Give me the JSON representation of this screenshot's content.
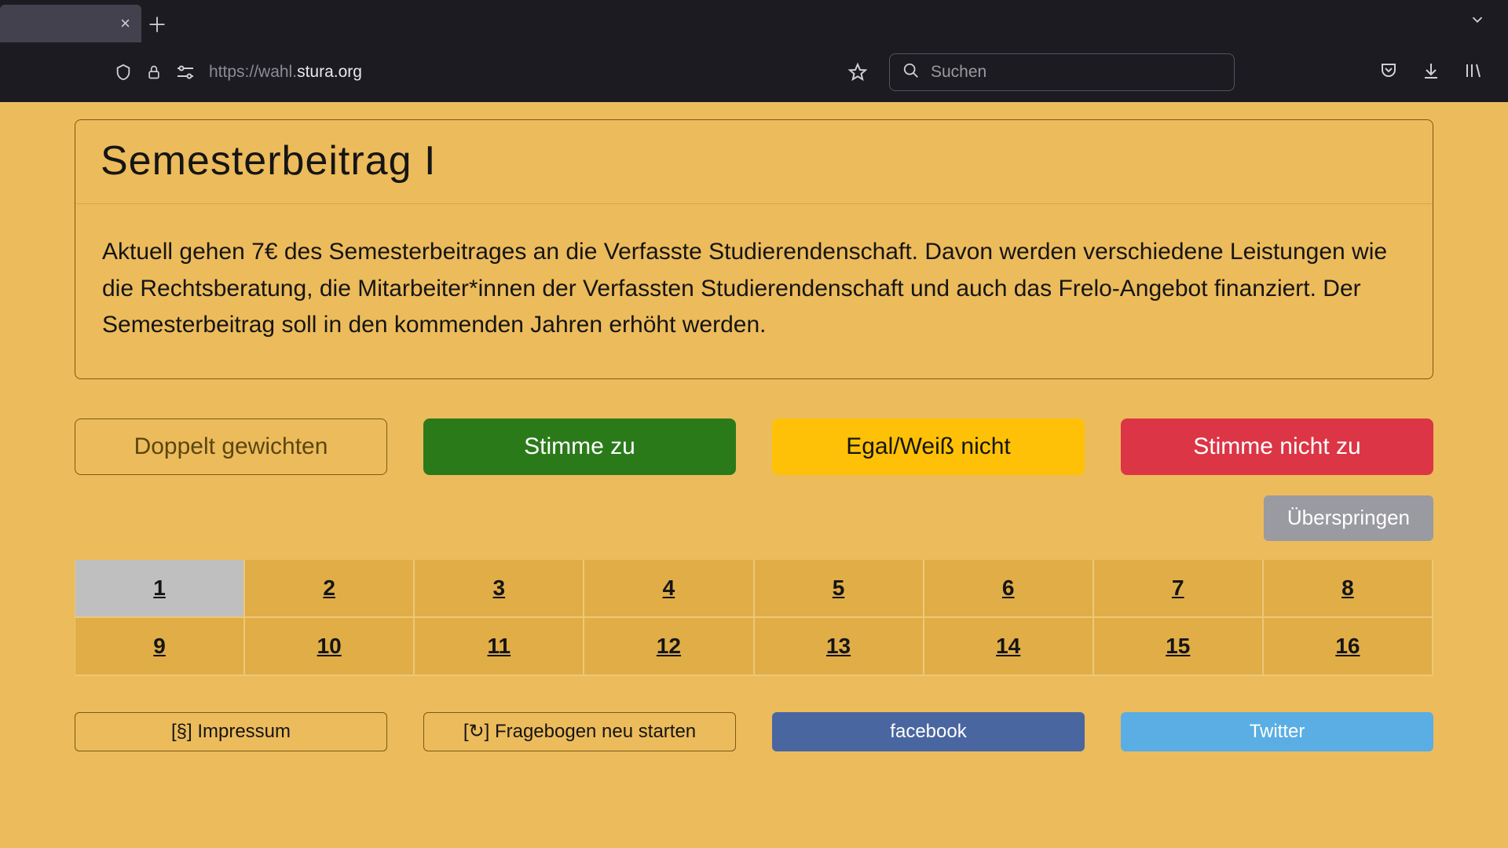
{
  "browser": {
    "url_prefix": "https://wahl.",
    "url_domain": "stura.org",
    "search_placeholder": "Suchen"
  },
  "card": {
    "title": "Semesterbeitrag I",
    "body": "Aktuell gehen 7€ des Semesterbeitrages an die Verfasste Studierendenschaft. Davon werden verschiedene Leistungen wie die Rechtsberatung, die Mitarbeiter*innen der Verfassten Studierendenschaft und auch das Frelo-Angebot finanziert. Der Semesterbeitrag soll in den kommenden Jahren erhöht werden."
  },
  "vote": {
    "weight": "Doppelt gewichten",
    "agree": "Stimme zu",
    "neutral": "Egal/Weiß nicht",
    "disagree": "Stimme nicht zu",
    "skip": "Überspringen"
  },
  "pager": {
    "items": [
      "1",
      "2",
      "3",
      "4",
      "5",
      "6",
      "7",
      "8",
      "9",
      "10",
      "11",
      "12",
      "13",
      "14",
      "15",
      "16"
    ],
    "active_index": 0
  },
  "footer": {
    "impressum": "[§] Impressum",
    "restart": "[↻] Fragebogen neu starten",
    "facebook": "facebook",
    "twitter": "Twitter"
  }
}
